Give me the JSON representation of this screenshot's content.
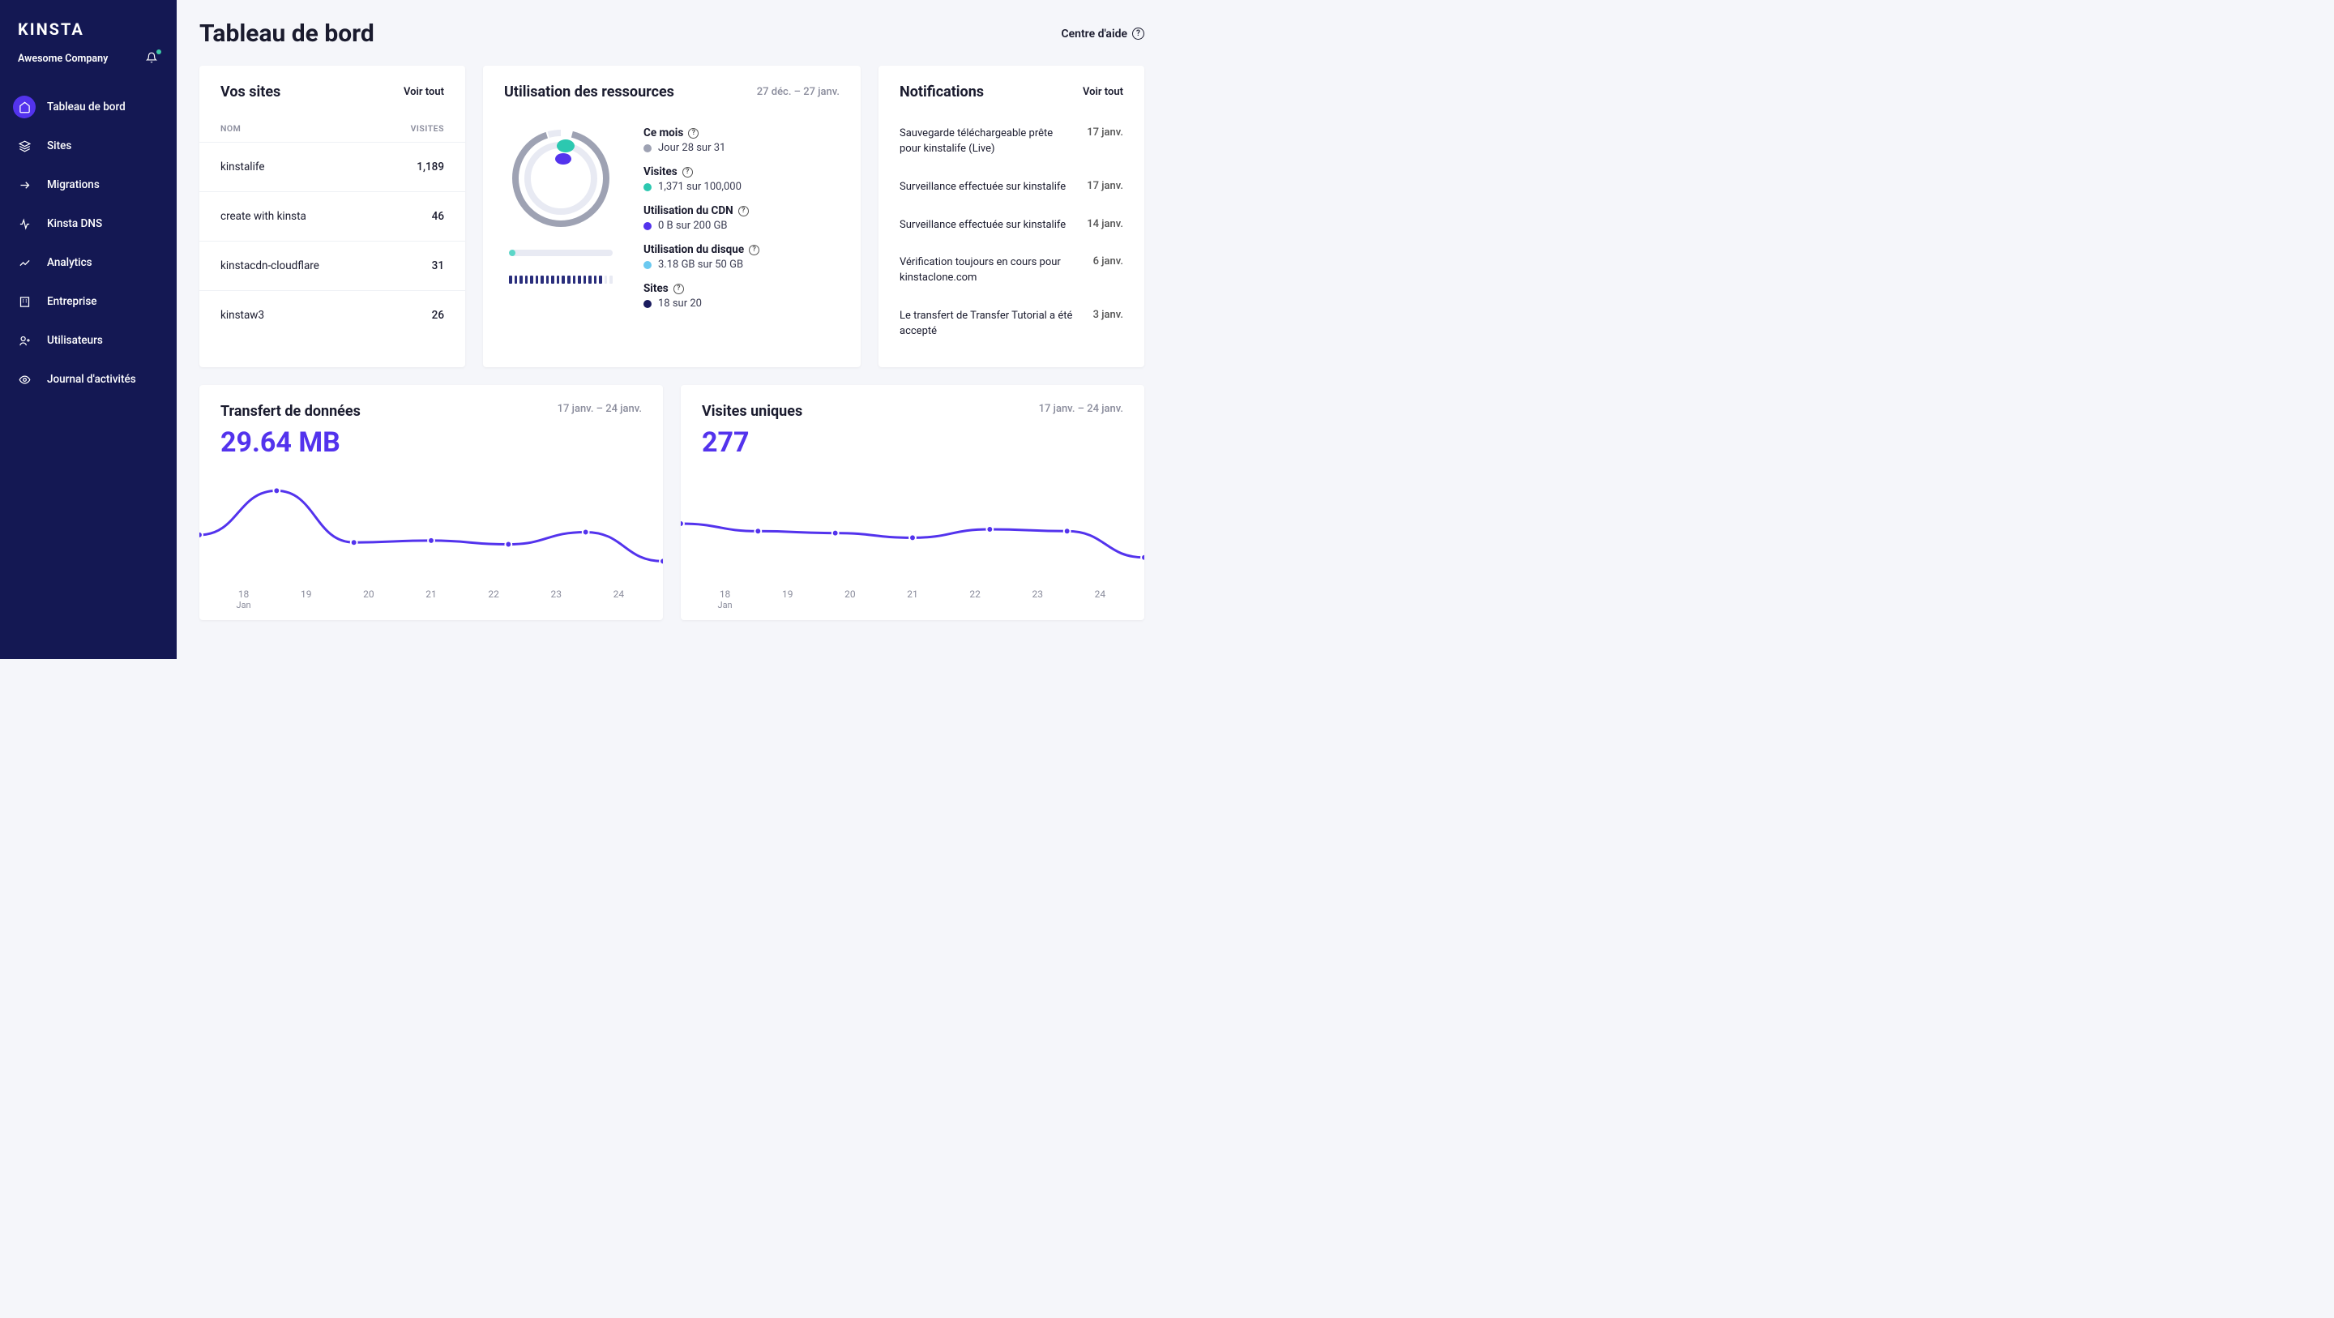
{
  "brand": "KINSTA",
  "company": "Awesome Company",
  "help_label": "Centre d'aide",
  "page_title": "Tableau de bord",
  "sidebar": {
    "items": [
      {
        "label": "Tableau de bord",
        "icon": "home-icon",
        "active": true
      },
      {
        "label": "Sites",
        "icon": "stack-icon",
        "active": false
      },
      {
        "label": "Migrations",
        "icon": "arrow-right-icon",
        "active": false
      },
      {
        "label": "Kinsta DNS",
        "icon": "dns-icon",
        "active": false
      },
      {
        "label": "Analytics",
        "icon": "chart-icon",
        "active": false
      },
      {
        "label": "Entreprise",
        "icon": "building-icon",
        "active": false
      },
      {
        "label": "Utilisateurs",
        "icon": "users-icon",
        "active": false
      },
      {
        "label": "Journal d'activités",
        "icon": "eye-icon",
        "active": false
      }
    ]
  },
  "sites_card": {
    "title": "Vos sites",
    "view_all": "Voir tout",
    "col_name": "NOM",
    "col_visits": "VISITES",
    "rows": [
      {
        "name": "kinstalife",
        "visits": "1,189"
      },
      {
        "name": "create with kinsta",
        "visits": "46"
      },
      {
        "name": "kinstacdn-cloudflare",
        "visits": "31"
      },
      {
        "name": "kinstaw3",
        "visits": "26"
      }
    ]
  },
  "usage_card": {
    "title": "Utilisation des ressources",
    "date_range": "27 déc. – 27 janv.",
    "metrics": {
      "month": {
        "label": "Ce mois",
        "value": "Jour 28 sur 31",
        "color": "#9ea2b3"
      },
      "visits": {
        "label": "Visites",
        "value": "1,371 sur 100,000",
        "color": "#2cc8b0"
      },
      "cdn": {
        "label": "Utilisation du CDN",
        "value": "0 B sur 200 GB",
        "color": "#5333ed"
      },
      "disk": {
        "label": "Utilisation du disque",
        "value": "3.18 GB sur 50 GB",
        "color": "#6bc9f0"
      },
      "sites": {
        "label": "Sites",
        "value": "18 sur 20",
        "color": "#1a1b5e"
      }
    },
    "disk_progress_pct": 6,
    "sites_segments_filled": 18,
    "sites_segments_total": 20
  },
  "notif_card": {
    "title": "Notifications",
    "view_all": "Voir tout",
    "items": [
      {
        "text": "Sauvegarde téléchargeable prête pour kinstalife (Live)",
        "date": "17 janv."
      },
      {
        "text": "Surveillance effectuée sur kinstalife",
        "date": "17 janv."
      },
      {
        "text": "Surveillance effectuée sur kinstalife",
        "date": "14 janv."
      },
      {
        "text": "Vérification toujours en cours pour kinstaclone.com",
        "date": "6 janv."
      },
      {
        "text": "Le transfert de Transfer Tutorial a été accepté",
        "date": "3 janv."
      }
    ]
  },
  "transfer_card": {
    "title": "Transfert de données",
    "date_range": "17 janv. – 24 janv.",
    "value": "29.64 MB"
  },
  "uniques_card": {
    "title": "Visites uniques",
    "date_range": "17 janv. – 24 janv.",
    "value": "277"
  },
  "chart_data": [
    {
      "type": "line",
      "title": "Transfert de données",
      "x": [
        "18",
        "19",
        "20",
        "21",
        "22",
        "23",
        "24"
      ],
      "x_sublabel": "Jan",
      "values": [
        38,
        85,
        30,
        32,
        28,
        41,
        10
      ],
      "ylim": [
        0,
        100
      ]
    },
    {
      "type": "line",
      "title": "Visites uniques",
      "x": [
        "18",
        "19",
        "20",
        "21",
        "22",
        "23",
        "24"
      ],
      "x_sublabel": "Jan",
      "values": [
        50,
        42,
        40,
        35,
        44,
        42,
        14
      ],
      "ylim": [
        0,
        100
      ]
    }
  ],
  "colors": {
    "accent": "#5333ed",
    "sidebar_bg": "#141853",
    "teal": "#2cc8b0"
  }
}
